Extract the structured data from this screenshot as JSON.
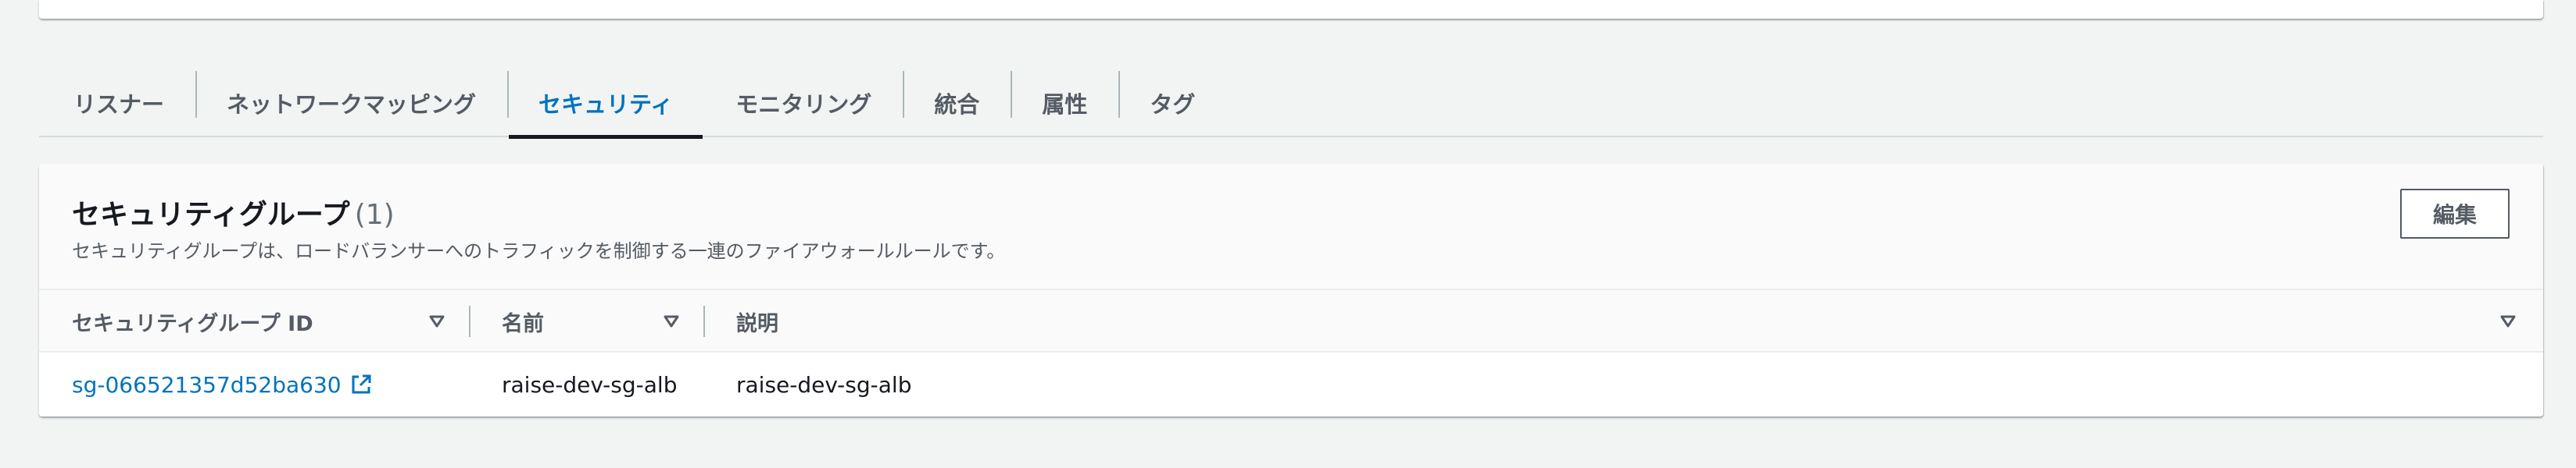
{
  "tabs": [
    {
      "label": "リスナー",
      "active": false
    },
    {
      "label": "ネットワークマッピング",
      "active": false
    },
    {
      "label": "セキュリティ",
      "active": true
    },
    {
      "label": "モニタリング",
      "active": false
    },
    {
      "label": "統合",
      "active": false
    },
    {
      "label": "属性",
      "active": false
    },
    {
      "label": "タグ",
      "active": false
    }
  ],
  "security_groups": {
    "title": "セキュリティグループ",
    "count": "(1)",
    "description": "セキュリティグループは、ロードバランサーへのトラフィックを制御する一連のファイアウォールルールです。",
    "edit_label": "編集",
    "columns": {
      "id": "セキュリティグループ ID",
      "name": "名前",
      "description": "説明"
    },
    "rows": [
      {
        "id": "sg-066521357d52ba630",
        "name": "raise-dev-sg-alb",
        "description": "raise-dev-sg-alb"
      }
    ]
  },
  "colors": {
    "link": "#0073bb",
    "active_tab": "#0073bb",
    "background": "#f2f3f3"
  },
  "icons": {
    "sort": "sort-caret-down-icon",
    "external_link": "external-link-icon"
  }
}
